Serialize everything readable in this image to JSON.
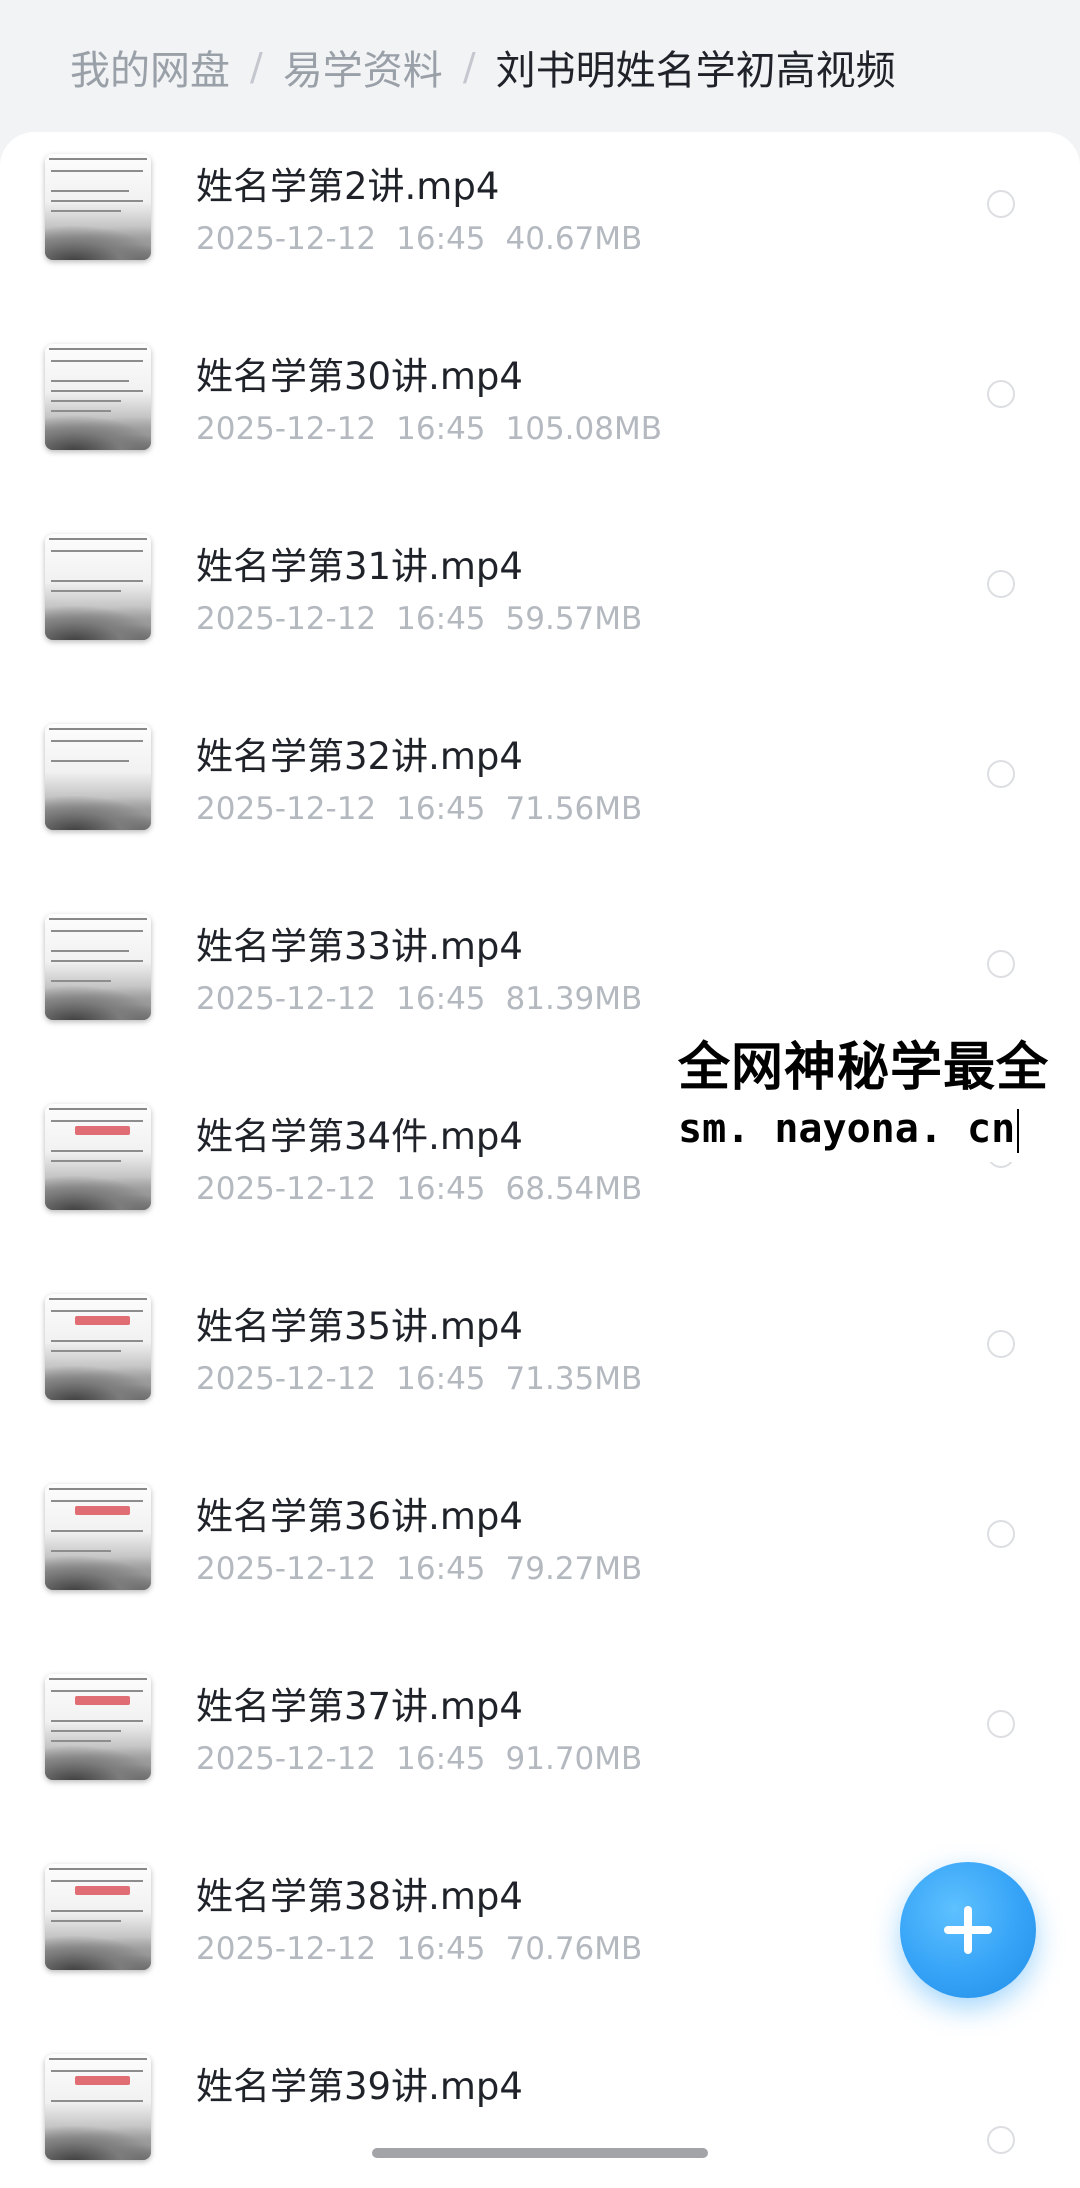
{
  "breadcrumb": {
    "items": [
      {
        "label": "我的网盘"
      },
      {
        "label": "易学资料"
      },
      {
        "label": "刘书明姓名学初高视频"
      }
    ]
  },
  "files": [
    {
      "name": "姓名学第2讲.mp4",
      "date": "2025-12-12",
      "time": "16:45",
      "size": "40.67MB"
    },
    {
      "name": "姓名学第30讲.mp4",
      "date": "2025-12-12",
      "time": "16:45",
      "size": "105.08MB"
    },
    {
      "name": "姓名学第31讲.mp4",
      "date": "2025-12-12",
      "time": "16:45",
      "size": "59.57MB"
    },
    {
      "name": "姓名学第32讲.mp4",
      "date": "2025-12-12",
      "time": "16:45",
      "size": "71.56MB"
    },
    {
      "name": "姓名学第33讲.mp4",
      "date": "2025-12-12",
      "time": "16:45",
      "size": "81.39MB"
    },
    {
      "name": "姓名学第34件.mp4",
      "date": "2025-12-12",
      "time": "16:45",
      "size": "68.54MB"
    },
    {
      "name": "姓名学第35讲.mp4",
      "date": "2025-12-12",
      "time": "16:45",
      "size": "71.35MB"
    },
    {
      "name": "姓名学第36讲.mp4",
      "date": "2025-12-12",
      "time": "16:45",
      "size": "79.27MB"
    },
    {
      "name": "姓名学第37讲.mp4",
      "date": "2025-12-12",
      "time": "16:45",
      "size": "91.70MB"
    },
    {
      "name": "姓名学第38讲.mp4",
      "date": "2025-12-12",
      "time": "16:45",
      "size": "70.76MB"
    },
    {
      "name": "姓名学第39讲.mp4"
    }
  ],
  "watermark": {
    "line1": "全网神秘学最全",
    "line2": "sm. nayona. cn"
  },
  "fab": {
    "icon": "plus-icon",
    "color": "#36A3F7"
  },
  "colors": {
    "page_bg": "#F2F3F5",
    "card_bg": "#FFFFFF",
    "text_primary": "#1F2329",
    "text_secondary": "#B4B8BF",
    "breadcrumb_muted": "#9AA0A8"
  }
}
